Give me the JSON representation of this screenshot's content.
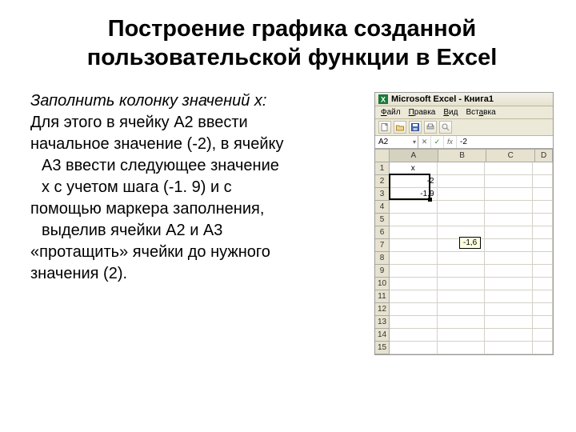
{
  "title": "Построение графика созданной пользовательской функции в Excel",
  "body": {
    "l1": "Заполнить колонку значений x:",
    "l2": "Для этого в ячейку А2 ввести",
    "l3": "начальное значение (-2), в ячейку",
    "l4": "А3 ввести следующее значение",
    "l5": "x с учетом шага (-1. 9) и с",
    "l6": "помощью маркера заполнения,",
    "l7": "выделив ячейки А2 и А3",
    "l8": "«протащить» ячейки до нужного",
    "l9": "значения (2)."
  },
  "excel": {
    "title_app": "Microsoft Excel - Книга1",
    "menu": {
      "file": "Файл",
      "edit": "Правка",
      "view": "Вид",
      "insert": "Вставка"
    },
    "namebox": "A2",
    "formula_value": "-2",
    "fx_label": "fx",
    "columns": [
      "A",
      "B",
      "C",
      "D"
    ],
    "rows": [
      {
        "n": "1",
        "a": "x",
        "aCenter": true
      },
      {
        "n": "2",
        "a": "-2"
      },
      {
        "n": "3",
        "a": "-1,9"
      },
      {
        "n": "4",
        "a": ""
      },
      {
        "n": "5",
        "a": ""
      },
      {
        "n": "6",
        "a": ""
      },
      {
        "n": "7",
        "a": ""
      },
      {
        "n": "8",
        "a": ""
      },
      {
        "n": "9",
        "a": ""
      },
      {
        "n": "10",
        "a": ""
      },
      {
        "n": "11",
        "a": ""
      },
      {
        "n": "12",
        "a": ""
      },
      {
        "n": "13",
        "a": ""
      },
      {
        "n": "14",
        "a": ""
      },
      {
        "n": "15",
        "a": ""
      }
    ],
    "tooltip": "-1,6"
  }
}
